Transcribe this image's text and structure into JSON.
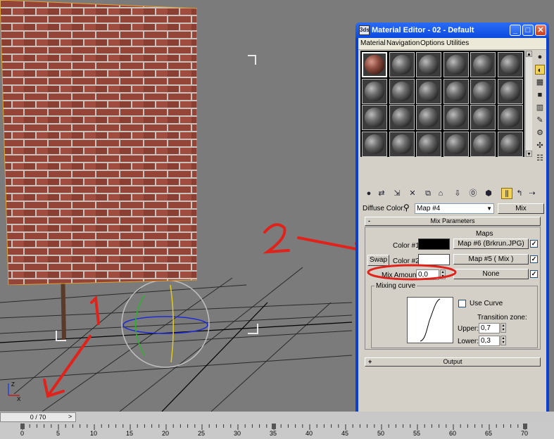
{
  "viewport": {
    "annotations": [
      {
        "label": "1",
        "color": "#e0221a"
      },
      {
        "label": "2",
        "color": "#e0221a"
      }
    ],
    "axis_labels": [
      "Z",
      "X"
    ]
  },
  "material_editor": {
    "title": "Material Editor - 02 - Default",
    "app_icon": "3ds",
    "window_buttons": [
      "_",
      "□",
      "✕"
    ],
    "menu": [
      "Material",
      "Navigation",
      "Options",
      "Utilities"
    ],
    "sample_slots": 24,
    "active_slot": 0,
    "diffuse_label": "Diffuse Color:",
    "map_dropdown": "Map #4",
    "type_button": "Mix",
    "mix_rollout": {
      "title": "Mix Parameters",
      "toggle": "-",
      "maps_header": "Maps",
      "swap": "Swap",
      "color1_label": "Color #1",
      "color1_value": "#000000",
      "color1_map": "Map #6 (Brkrun.JPG)",
      "color2_label": "Color #2",
      "color2_value": "#ffffff",
      "color2_map": "Map #5  ( Mix )",
      "mix_amount_label": "Mix Amount:",
      "mix_amount_value": "0,0",
      "mix_map": "None",
      "mixing_curve_label": "Mixing curve",
      "use_curve_label": "Use Curve",
      "transition_zone_label": "Transition zone:",
      "upper_label": "Upper:",
      "upper_value": "0,7",
      "lower_label": "Lower:",
      "lower_value": "0,3"
    },
    "output_rollout": {
      "title": "Output",
      "toggle": "+"
    }
  },
  "timeline": {
    "frame_display": "0 / 70",
    "ticks": [
      "0",
      "5",
      "10",
      "15",
      "20",
      "25",
      "30",
      "35",
      "40",
      "45",
      "50",
      "55",
      "60",
      "65",
      "70"
    ]
  }
}
